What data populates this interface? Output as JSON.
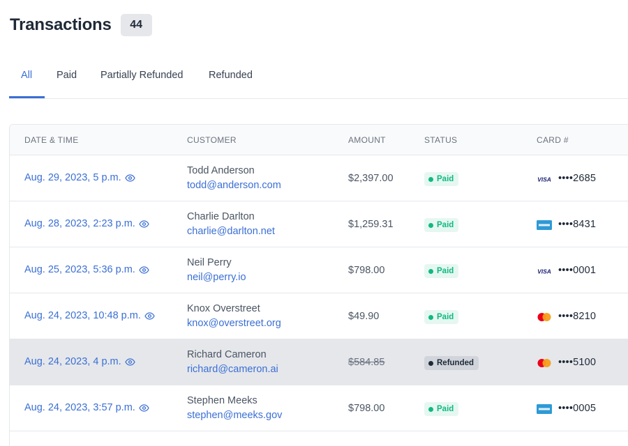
{
  "header": {
    "title": "Transactions",
    "count": "44"
  },
  "tabs": [
    {
      "label": "All",
      "active": true
    },
    {
      "label": "Paid"
    },
    {
      "label": "Partially Refunded"
    },
    {
      "label": "Refunded"
    }
  ],
  "table": {
    "columns": [
      "Date & Time",
      "Customer",
      "Amount",
      "Status",
      "Card #"
    ],
    "rows": [
      {
        "date": "Aug. 29, 2023, 5 p.m.",
        "name": "Todd Anderson",
        "email": "todd@anderson.com",
        "amount": "$2,397.00",
        "status": "Paid",
        "card_brand": "visa",
        "card": "••••2685"
      },
      {
        "date": "Aug. 28, 2023, 2:23 p.m.",
        "name": "Charlie Darlton",
        "email": "charlie@darlton.net",
        "amount": "$1,259.31",
        "status": "Paid",
        "card_brand": "amex",
        "card": "••••8431"
      },
      {
        "date": "Aug. 25, 2023, 5:36 p.m.",
        "name": "Neil Perry",
        "email": "neil@perry.io",
        "amount": "$798.00",
        "status": "Paid",
        "card_brand": "visa",
        "card": "••••0001"
      },
      {
        "date": "Aug. 24, 2023, 10:48 p.m.",
        "name": "Knox Overstreet",
        "email": "knox@overstreet.org",
        "amount": "$49.90",
        "status": "Paid",
        "card_brand": "mastercard",
        "card": "••••8210"
      },
      {
        "date": "Aug. 24, 2023, 4 p.m.",
        "name": "Richard Cameron",
        "email": "richard@cameron.ai",
        "amount": "$584.85",
        "status": "Refunded",
        "card_brand": "mastercard",
        "card": "••••5100"
      },
      {
        "date": "Aug. 24, 2023, 3:57 p.m.",
        "name": "Stephen Meeks",
        "email": "stephen@meeks.gov",
        "amount": "$798.00",
        "status": "Paid",
        "card_brand": "amex",
        "card": "••••0005"
      }
    ]
  },
  "colors": {
    "accent": "#3b6fd4",
    "paid": "#10b981",
    "refunded": "#1f2937"
  }
}
